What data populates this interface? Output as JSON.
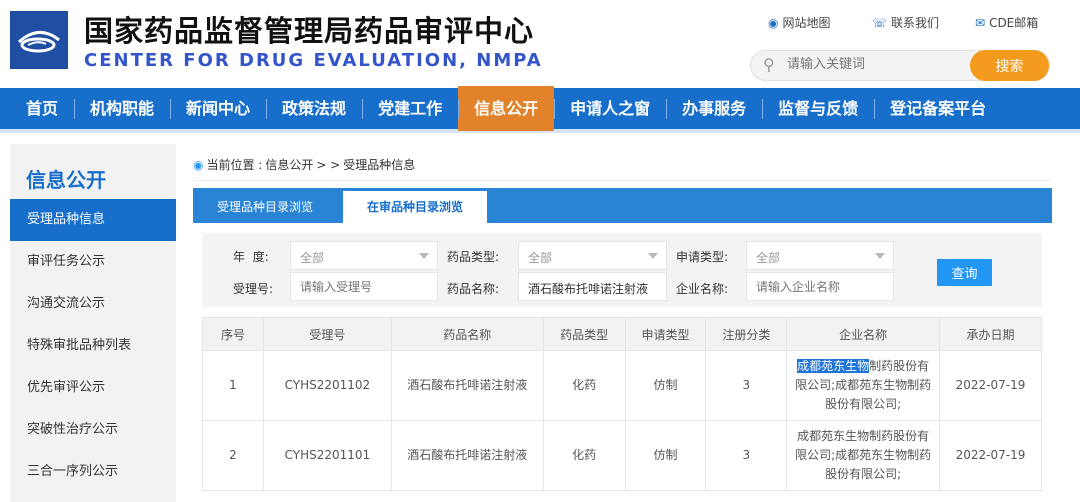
{
  "header": {
    "title_cn": "国家药品监督管理局药品审评中心",
    "title_en": "CENTER FOR DRUG EVALUATION, NMPA",
    "links": [
      {
        "label": "网站地图",
        "icon": "location-pin-icon"
      },
      {
        "label": "联系我们",
        "icon": "phone-icon"
      },
      {
        "label": "CDE邮箱",
        "icon": "mail-icon"
      }
    ],
    "search_placeholder": "请输入关键词",
    "search_button": "搜索"
  },
  "nav": [
    "首页",
    "机构职能",
    "新闻中心",
    "政策法规",
    "党建工作",
    "信息公开",
    "申请人之窗",
    "办事服务",
    "监督与反馈",
    "登记备案平台"
  ],
  "nav_active": "信息公开",
  "sidebar": {
    "title": "信息公开",
    "items": [
      "受理品种信息",
      "审评任务公示",
      "沟通交流公示",
      "特殊审批品种列表",
      "优先审评公示",
      "突破性治疗公示",
      "三合一序列公示"
    ]
  },
  "breadcrumb": {
    "prefix": "当前位置 :",
    "path": "信息公开",
    "sep": "> >",
    "current": "受理品种信息"
  },
  "tabs": [
    "受理品种目录浏览",
    "在审品种目录浏览"
  ],
  "filter": {
    "year_label": "年  度:",
    "year_value": "全部",
    "drug_type_label": "药品类型:",
    "drug_type_value": "全部",
    "app_type_label": "申请类型:",
    "app_type_value": "全部",
    "accept_no_label": "受理号:",
    "accept_no_placeholder": "请输入受理号",
    "drug_name_label": "药品名称:",
    "drug_name_value": "酒石酸布托啡诺注射液",
    "company_label": "企业名称:",
    "company_placeholder": "请输入企业名称",
    "query_button": "查询"
  },
  "table": {
    "headers": [
      "序号",
      "受理号",
      "药品名称",
      "药品类型",
      "申请类型",
      "注册分类",
      "企业名称",
      "承办日期"
    ],
    "rows": [
      {
        "no": "1",
        "accept_no": "CYHS2201102",
        "drug": "酒石酸布托啡诺注射液",
        "type": "化药",
        "app": "仿制",
        "reg": "3",
        "company_selected": "成都苑东生物",
        "company_rest": "制药股份有限公司;成都苑东生物制药股份有限公司;",
        "date": "2022-07-19"
      },
      {
        "no": "2",
        "accept_no": "CYHS2201101",
        "drug": "酒石酸布托啡诺注射液",
        "type": "化药",
        "app": "仿制",
        "reg": "3",
        "company": "成都苑东生物制药股份有限公司;成都苑东生物制药股份有限公司;",
        "date": "2022-07-19"
      }
    ]
  }
}
